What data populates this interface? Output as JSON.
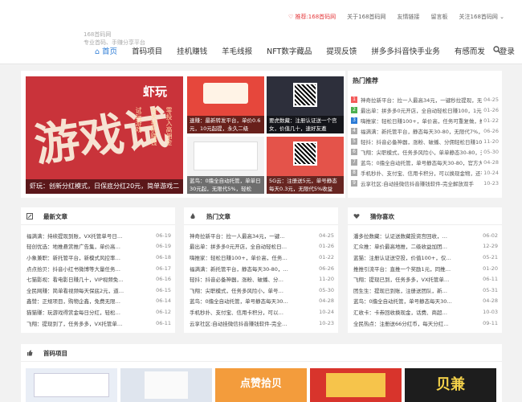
{
  "topbar": {
    "links": [
      {
        "label": "♡ 推荐:168首码网",
        "color": "red"
      },
      {
        "label": "关于168首码网"
      },
      {
        "label": "友情链接"
      },
      {
        "label": "留言板"
      },
      {
        "label": "关注168首码网 ⌄"
      }
    ]
  },
  "header": {
    "logo_lines": [
      "168首码网",
      "专业首码、手赚分享平台"
    ],
    "nav": [
      "⌂ 首页",
      "首码项目",
      "挂机赚钱",
      "羊毛线报",
      "NFT数字藏品",
      "提现反馈",
      "拼多多抖音快手业务",
      "有感而发",
      "登录"
    ]
  },
  "slider": {
    "big": {
      "char": "游戏试",
      "brand": "虾玩",
      "cols": [
        "试玩游戏",
        "每天挂机赚钱",
        "零投入高佣金"
      ],
      "caption": "虾玩：创新分红模式，日保底分红20元，简单游戏二"
    },
    "small": [
      {
        "caption": "速赚：最新转发平台，单价0.6元，10元起提，永久二级"
      },
      {
        "caption": "要虎数藏：注册认证送一个宫女，价值几十，速好友邀"
      },
      {
        "caption": "蓝鸟：0撸全自动托管，单单日30元起，无限代5%，轻松"
      },
      {
        "caption": "5G云：注册送5元，单号静态每天0.3元，无限代5%收益"
      }
    ]
  },
  "hot": {
    "title": "热门推荐",
    "items": [
      {
        "n": "1",
        "color": "#f45b5b",
        "text": "神奇拉新平台：拉一人最高34元，一键秒拉提现，无限",
        "date": "04-25"
      },
      {
        "n": "2",
        "color": "#4cb050",
        "text": "最出单：拼多多0元开店，全自动轻松日赚100，1元起提",
        "date": "01-26"
      },
      {
        "n": "3",
        "color": "#2b7bd6",
        "text": "嗨推家：轻松日赚100+，单价高，任务可重复做，推广",
        "date": "01-22"
      },
      {
        "n": "4",
        "color": "#aaa",
        "text": "福满满：新托管平台，静态每天30-80，无限代7%，注册",
        "date": "06-26"
      },
      {
        "n": "5",
        "color": "#aaa",
        "text": "轻抖：抖音必备神器，涨粉、破播、分佣轻松日赚100",
        "date": "11-20"
      },
      {
        "n": "6",
        "color": "#aaa",
        "text": "飞翔：尖职模式，任务多风险小，单单静态30-80，无限",
        "date": "05-30"
      },
      {
        "n": "7",
        "color": "#aaa",
        "text": "蓝鸟：0撸全自动托管，单号静态每天30-80，官方大力",
        "date": "04-28"
      },
      {
        "n": "8",
        "color": "#aaa",
        "text": "手机秒扑、支付宝、信用卡积分，可以换现金物，还有",
        "date": "10-24"
      },
      {
        "n": "9",
        "color": "#aaa",
        "text": "云享社区:自动挂微信抖音赚钱软件-完全解放双手",
        "date": "10-23"
      }
    ]
  },
  "latest": {
    "title": "最新文章",
    "items": [
      {
        "text": "福满满：持续提现到账，VX托管单号日…",
        "date": "06-19"
      },
      {
        "text": "轻创优选：地推悬赏推广告集，单价高…",
        "date": "06-19"
      },
      {
        "text": "小象兼职：新托管平台，新模式风控率…",
        "date": "06-18"
      },
      {
        "text": "点点拾贝：抖音小红书微博等大量任务…",
        "date": "06-17"
      },
      {
        "text": "七猫影视：看电影日赚几十，VIP视频免…",
        "date": "06-16"
      },
      {
        "text": "全民网赚：简单看视频每天保底2元，道…",
        "date": "06-15"
      },
      {
        "text": "鑫赞：正规项目，购物企鑫，免费无限…",
        "date": "06-14"
      },
      {
        "text": "猫猫赚：玩游戏得赏金每日分红，轻松…",
        "date": "06-12"
      },
      {
        "text": "飞翔：提现到了，任务多多，VX托管单…",
        "date": "06-11"
      }
    ]
  },
  "hotart": {
    "title": "热门文章",
    "items": [
      {
        "text": "神奇拉新平台：拉一人最高34元，一键…",
        "date": "04-25"
      },
      {
        "text": "最出单：拼多多0元开店，全自动轻松日…",
        "date": "01-26"
      },
      {
        "text": "嗨推家：轻松日赚100+，单价高，任务…",
        "date": "01-22"
      },
      {
        "text": "福满满：新托管平台，静态每天30-80，…",
        "date": "06-26"
      },
      {
        "text": "轻抖：抖音必备神器，涨粉、破播、分…",
        "date": "11-20"
      },
      {
        "text": "飞翔：尖职模式，任务多风险小，单号…",
        "date": "05-30"
      },
      {
        "text": "蓝鸟：0撸全自动托管，单号静态每天30…",
        "date": "04-28"
      },
      {
        "text": "手机秒扑、支付宝、信用卡积分，可以…",
        "date": "10-24"
      },
      {
        "text": "云享社区:自动挂微信抖音赚钱软件-完全…",
        "date": "10-23"
      }
    ]
  },
  "guess": {
    "title": "猜你喜欢",
    "items": [
      {
        "text": "潘多拉数藏：认证送数藏投资宫回收，…",
        "date": "06-02"
      },
      {
        "text": "汇众推：单价最高地推，二级收益加团…",
        "date": "12-29"
      },
      {
        "text": "蓝猫：注册认证送空投，价值100+，仅…",
        "date": "05-21"
      },
      {
        "text": "推推引流平台：直推一个奖励1元，同推…",
        "date": "01-20"
      },
      {
        "text": "飞翔：提现已到，任务多多，VX托管单…",
        "date": "06-11"
      },
      {
        "text": "团生生：提现已到账，注册送团队，新…",
        "date": "05-31"
      },
      {
        "text": "蓝鸟：0撸全自动托管，单号静态每天30…",
        "date": "04-28"
      },
      {
        "text": "汇收卡：卡券回收换现金，话费、商超…",
        "date": "10-03"
      },
      {
        "text": "全民热点：注册送66分红币，每天分红…",
        "date": "09-11"
      }
    ]
  },
  "projects": {
    "title": "首码项目",
    "thumbs": [
      "",
      "",
      "点赞拾贝",
      "",
      "贝兼"
    ]
  },
  "colors": {
    "accent": "#2b7bd6",
    "red": "#e4393c"
  }
}
